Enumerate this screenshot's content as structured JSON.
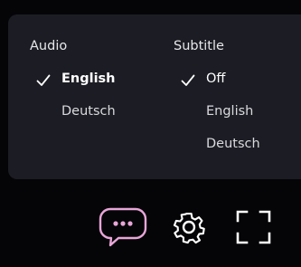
{
  "audio": {
    "heading": "Audio",
    "options": [
      {
        "label": "English",
        "selected": true
      },
      {
        "label": "Deutsch",
        "selected": false
      }
    ]
  },
  "subtitle": {
    "heading": "Subtitle",
    "options": [
      {
        "label": "Off",
        "selected": true
      },
      {
        "label": "English",
        "selected": false
      },
      {
        "label": "Deutsch",
        "selected": false
      }
    ]
  },
  "controls": {
    "subtitles_icon": "speech-bubble-icon",
    "settings_icon": "gear-icon",
    "fullscreen_icon": "fullscreen-icon",
    "accent_color": "#e8a6d8"
  }
}
